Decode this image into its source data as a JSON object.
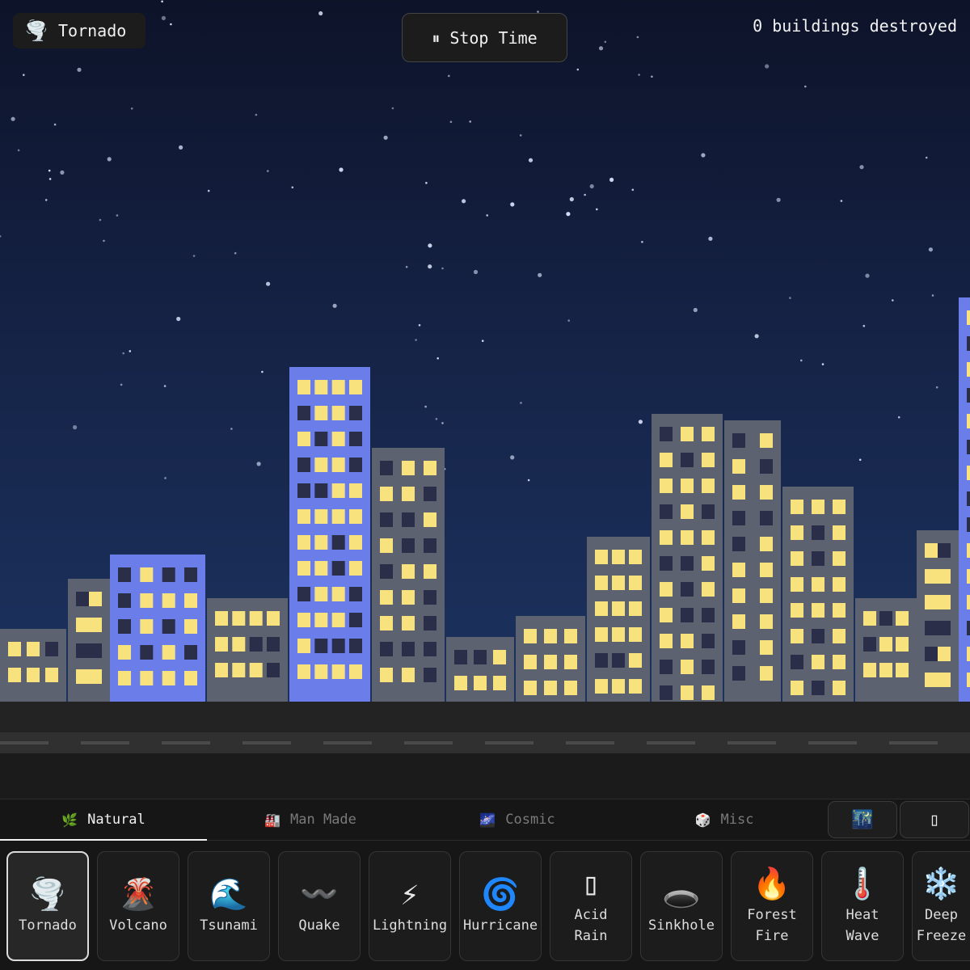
{
  "hud": {
    "current_disaster": {
      "icon": "tornado-icon",
      "glyph": "🌪️",
      "label": "Tornado"
    },
    "time_button": {
      "icon": "pause-icon",
      "glyph": "⏸",
      "label": "Stop Time"
    },
    "counter": "0 buildings destroyed"
  },
  "tabs": [
    {
      "icon": "herb-icon",
      "glyph": "🌿",
      "label": "Natural",
      "active": true
    },
    {
      "icon": "factory-icon",
      "glyph": "🏭",
      "label": "Man Made",
      "active": false
    },
    {
      "icon": "milky-way-icon",
      "glyph": "🌌",
      "label": "Cosmic",
      "active": false
    },
    {
      "icon": "die-icon",
      "glyph": "🎲",
      "label": "Misc",
      "active": false
    }
  ],
  "toolbar_buttons": [
    {
      "icon": "night-city-icon",
      "glyph": "🌃"
    },
    {
      "icon": "unknown-glyph-icon",
      "glyph": "▯"
    }
  ],
  "disasters": [
    {
      "id": "tornado",
      "icon": "tornado-icon",
      "glyph": "🌪️",
      "label": "Tornado",
      "selected": true
    },
    {
      "id": "volcano",
      "icon": "volcano-icon",
      "glyph": "🌋",
      "label": "Volcano"
    },
    {
      "id": "tsunami",
      "icon": "wave-icon",
      "glyph": "🌊",
      "label": "Tsunami"
    },
    {
      "id": "quake",
      "icon": "wavy-dash-icon",
      "glyph": "〰️",
      "label": "Quake"
    },
    {
      "id": "lightning",
      "icon": "lightning-icon",
      "glyph": "⚡",
      "label": "Lightning"
    },
    {
      "id": "hurricane",
      "icon": "cyclone-icon",
      "glyph": "🌀",
      "label": "Hurricane"
    },
    {
      "id": "acid-rain",
      "icon": "unknown-glyph-icon",
      "glyph": "▯",
      "label": "Acid\nRain"
    },
    {
      "id": "sinkhole",
      "icon": "hole-icon",
      "glyph": "🕳️",
      "label": "Sinkhole"
    },
    {
      "id": "forest-fire",
      "icon": "fire-icon",
      "glyph": "🔥",
      "label": "Forest\nFire"
    },
    {
      "id": "heat-wave",
      "icon": "thermometer-icon",
      "glyph": "🌡️",
      "label": "Heat\nWave"
    },
    {
      "id": "deep-freeze",
      "icon": "snowflake-icon",
      "glyph": "❄️",
      "label": "Deep\nFreeze"
    }
  ],
  "colors": {
    "sky_top": "#0d1329",
    "sky_bottom": "#1d3766",
    "building_gray": "#5d6270",
    "building_blue": "#6a7de8",
    "window_lit": "#f7e27d",
    "window_dark": "#2a2e48"
  }
}
